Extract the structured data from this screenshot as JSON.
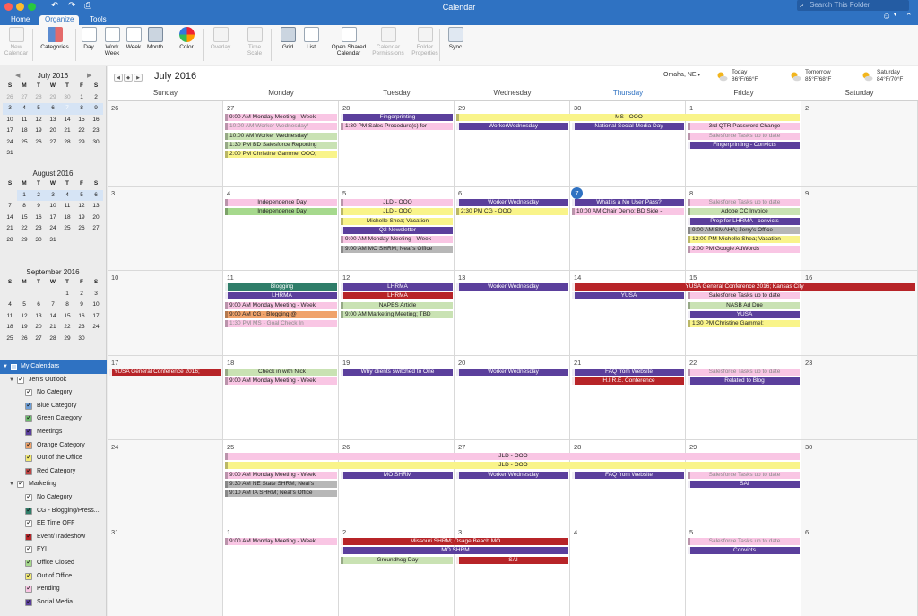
{
  "window": {
    "title": "Calendar",
    "search_placeholder": "Search This Folder"
  },
  "ribbon_tabs": [
    "Home",
    "Organize",
    "Tools"
  ],
  "toolbar": {
    "buttons": [
      {
        "label": "New\nCalendar",
        "disabled": true
      },
      {
        "label": "Categories",
        "disabled": false
      },
      {
        "label": "Day",
        "disabled": false
      },
      {
        "label": "Work\nWeek",
        "disabled": false
      },
      {
        "label": "Week",
        "disabled": false
      },
      {
        "label": "Month",
        "disabled": false,
        "selected": true
      },
      {
        "label": "Color",
        "disabled": false
      },
      {
        "label": "Overlay",
        "disabled": true
      },
      {
        "label": "Time\nScale",
        "disabled": true
      },
      {
        "label": "Grid",
        "disabled": false,
        "selected": true
      },
      {
        "label": "List",
        "disabled": false
      },
      {
        "label": "Open Shared\nCalendar",
        "disabled": false
      },
      {
        "label": "Calendar\nPermissions",
        "disabled": true
      },
      {
        "label": "Folder\nProperties",
        "disabled": true
      },
      {
        "label": "Sync",
        "disabled": false
      }
    ]
  },
  "colors": {
    "accent": "#2f72c2",
    "purple": "#5b3f9c",
    "pink": "#f9c6e4",
    "yellow": "#f9f48a",
    "green": "#c9e2b3",
    "gray": "#b7b7b7",
    "red": "#b72428",
    "teal": "#2f7d69",
    "orange": "#f0a36b",
    "bright_green": "#a6d98d"
  },
  "mini_calendars": [
    {
      "title": "July 2016",
      "days": [
        "S",
        "M",
        "T",
        "W",
        "T",
        "F",
        "S"
      ],
      "cells": [
        [
          "26",
          "o"
        ],
        [
          "27",
          "o"
        ],
        [
          "28",
          "o"
        ],
        [
          "29",
          "o"
        ],
        [
          "30",
          "o"
        ],
        [
          "1",
          ""
        ],
        [
          "2",
          ""
        ],
        [
          "3",
          "s"
        ],
        [
          "4",
          "s"
        ],
        [
          "5",
          "s"
        ],
        [
          "6",
          "s"
        ],
        [
          "7",
          "t"
        ],
        [
          "8",
          "s"
        ],
        [
          "9",
          "s"
        ],
        [
          "10",
          ""
        ],
        [
          "11",
          ""
        ],
        [
          "12",
          ""
        ],
        [
          "13",
          ""
        ],
        [
          "14",
          ""
        ],
        [
          "15",
          ""
        ],
        [
          "16",
          ""
        ],
        [
          "17",
          ""
        ],
        [
          "18",
          ""
        ],
        [
          "19",
          ""
        ],
        [
          "20",
          ""
        ],
        [
          "21",
          ""
        ],
        [
          "22",
          ""
        ],
        [
          "23",
          ""
        ],
        [
          "24",
          ""
        ],
        [
          "25",
          ""
        ],
        [
          "26",
          ""
        ],
        [
          "27",
          ""
        ],
        [
          "28",
          ""
        ],
        [
          "29",
          ""
        ],
        [
          "30",
          ""
        ],
        [
          "31",
          ""
        ]
      ]
    },
    {
      "title": "August 2016",
      "days": [
        "S",
        "M",
        "T",
        "W",
        "T",
        "F",
        "S"
      ],
      "cells": [
        [
          "",
          "o"
        ],
        [
          "1",
          "s"
        ],
        [
          "2",
          "s"
        ],
        [
          "3",
          "s"
        ],
        [
          "4",
          "s"
        ],
        [
          "5",
          "s"
        ],
        [
          "6",
          "s"
        ],
        [
          "7",
          ""
        ],
        [
          "8",
          ""
        ],
        [
          "9",
          ""
        ],
        [
          "10",
          ""
        ],
        [
          "11",
          ""
        ],
        [
          "12",
          ""
        ],
        [
          "13",
          ""
        ],
        [
          "14",
          ""
        ],
        [
          "15",
          ""
        ],
        [
          "16",
          ""
        ],
        [
          "17",
          ""
        ],
        [
          "18",
          ""
        ],
        [
          "19",
          ""
        ],
        [
          "20",
          ""
        ],
        [
          "21",
          ""
        ],
        [
          "22",
          ""
        ],
        [
          "23",
          ""
        ],
        [
          "24",
          ""
        ],
        [
          "25",
          ""
        ],
        [
          "26",
          ""
        ],
        [
          "27",
          ""
        ],
        [
          "28",
          ""
        ],
        [
          "29",
          ""
        ],
        [
          "30",
          ""
        ],
        [
          "31",
          ""
        ]
      ]
    },
    {
      "title": "September 2016",
      "days": [
        "S",
        "M",
        "T",
        "W",
        "T",
        "F",
        "S"
      ],
      "cells": [
        [
          "",
          "o"
        ],
        [
          "",
          "o"
        ],
        [
          "",
          "o"
        ],
        [
          "",
          "o"
        ],
        [
          "1",
          ""
        ],
        [
          "2",
          ""
        ],
        [
          "3",
          ""
        ],
        [
          "4",
          ""
        ],
        [
          "5",
          ""
        ],
        [
          "6",
          ""
        ],
        [
          "7",
          ""
        ],
        [
          "8",
          ""
        ],
        [
          "9",
          ""
        ],
        [
          "10",
          ""
        ],
        [
          "11",
          ""
        ],
        [
          "12",
          ""
        ],
        [
          "13",
          ""
        ],
        [
          "14",
          ""
        ],
        [
          "15",
          ""
        ],
        [
          "16",
          ""
        ],
        [
          "17",
          ""
        ],
        [
          "18",
          ""
        ],
        [
          "19",
          ""
        ],
        [
          "20",
          ""
        ],
        [
          "21",
          ""
        ],
        [
          "22",
          ""
        ],
        [
          "23",
          ""
        ],
        [
          "24",
          ""
        ],
        [
          "25",
          ""
        ],
        [
          "26",
          ""
        ],
        [
          "27",
          ""
        ],
        [
          "28",
          ""
        ],
        [
          "29",
          ""
        ],
        [
          "30",
          ""
        ]
      ]
    }
  ],
  "calendars": {
    "header": "My Calendars",
    "groups": [
      {
        "name": "Jen's Outlook",
        "items": [
          {
            "label": "No Category",
            "color": "#ffffff"
          },
          {
            "label": "Blue Category",
            "color": "#6e9fd8"
          },
          {
            "label": "Green Category",
            "color": "#6ebd6e"
          },
          {
            "label": "Meetings",
            "color": "#5b3f9c"
          },
          {
            "label": "Orange Category",
            "color": "#f0a36b"
          },
          {
            "label": "Out of the Office",
            "color": "#f3ea73"
          },
          {
            "label": "Red Category",
            "color": "#c04545"
          }
        ]
      },
      {
        "name": "Marketing",
        "items": [
          {
            "label": "No Category",
            "color": "#ffffff"
          },
          {
            "label": "CG - Blogging/Press...",
            "color": "#2f7d69"
          },
          {
            "label": "EE Time OFF",
            "color": "#ffffff"
          },
          {
            "label": "Event/Tradeshow",
            "color": "#b72428"
          },
          {
            "label": "FYI",
            "color": "#ffffff"
          },
          {
            "label": "Office Closed",
            "color": "#a6d98d"
          },
          {
            "label": "Out of Office",
            "color": "#f3ea73"
          },
          {
            "label": "Pending",
            "color": "#f9c6e4"
          },
          {
            "label": "Social Media",
            "color": "#5b3f9c"
          }
        ]
      }
    ]
  },
  "header": {
    "month_title": "July 2016",
    "location": "Omaha, NE",
    "weather": [
      {
        "day": "Today",
        "temps": "86°F/66°F"
      },
      {
        "day": "Tomorrow",
        "temps": "85°F/68°F"
      },
      {
        "day": "Saturday",
        "temps": "84°F/70°F"
      }
    ]
  },
  "weekdays": [
    "Sunday",
    "Monday",
    "Tuesday",
    "Wednesday",
    "Thursday",
    "Friday",
    "Saturday"
  ],
  "today_index": 4,
  "weeks": [
    [
      "26",
      "27",
      "28",
      "29",
      "30",
      "1",
      "2"
    ],
    [
      "3",
      "4",
      "5",
      "6",
      "7",
      "8",
      "9"
    ],
    [
      "10",
      "11",
      "12",
      "13",
      "14",
      "15",
      "16"
    ],
    [
      "17",
      "18",
      "19",
      "20",
      "21",
      "22",
      "23"
    ],
    [
      "24",
      "25",
      "26",
      "27",
      "28",
      "29",
      "30"
    ],
    [
      "31",
      "1",
      "2",
      "3",
      "4",
      "5",
      "6"
    ]
  ],
  "today_cell": [
    1,
    4
  ],
  "events": [
    {
      "w": 0,
      "d": 1,
      "s": 1,
      "r": 0,
      "k": "pink",
      "t": "9:00 AM   Monday Meeting - Week"
    },
    {
      "w": 0,
      "d": 1,
      "s": 1,
      "r": 1,
      "k": "pinkf",
      "t": "10:00 AM  Worker Wednesday/"
    },
    {
      "w": 0,
      "d": 1,
      "s": 1,
      "r": 2,
      "k": "green",
      "t": "10:00 AM  Worker Wednesday/"
    },
    {
      "w": 0,
      "d": 1,
      "s": 1,
      "r": 3,
      "k": "green",
      "t": "1:30 PM  BD Salesforce Reporting"
    },
    {
      "w": 0,
      "d": 1,
      "s": 1,
      "r": 4,
      "k": "yellow",
      "t": "2:00 PM   Christine Gammel OOO;"
    },
    {
      "w": 0,
      "d": 2,
      "s": 1,
      "r": 0,
      "k": "purple",
      "t": "Fingerprinting",
      "c": 1
    },
    {
      "w": 0,
      "d": 2,
      "s": 1,
      "r": 1,
      "k": "pink",
      "t": "1:30 PM  Sales Procedure(s) for"
    },
    {
      "w": 0,
      "d": 3,
      "s": 3,
      "r": 0,
      "k": "yellow",
      "t": "MS - OOO",
      "c": 1
    },
    {
      "w": 0,
      "d": 3,
      "s": 1,
      "r": 1,
      "k": "purple",
      "t": "WorkerWednesday",
      "c": 1
    },
    {
      "w": 0,
      "d": 4,
      "s": 1,
      "r": 1,
      "k": "purple",
      "t": "National Social Media Day",
      "c": 1
    },
    {
      "w": 0,
      "d": 5,
      "s": 1,
      "r": 1,
      "k": "pink",
      "t": "3rd QTR Password Change",
      "c": 1
    },
    {
      "w": 0,
      "d": 5,
      "s": 1,
      "r": 2,
      "k": "pinkf",
      "t": "Salesforce Tasks up to date",
      "c": 1
    },
    {
      "w": 0,
      "d": 5,
      "s": 1,
      "r": 3,
      "k": "purple",
      "t": "Fingerprinting - Convicts",
      "c": 1
    },
    {
      "w": 1,
      "d": 1,
      "s": 1,
      "r": 0,
      "k": "pink",
      "t": "Independence Day",
      "c": 1
    },
    {
      "w": 1,
      "d": 1,
      "s": 1,
      "r": 1,
      "k": "bgreen",
      "t": "Independence Day",
      "c": 1
    },
    {
      "w": 1,
      "d": 2,
      "s": 1,
      "r": 0,
      "k": "pink",
      "t": "JLD - OOO",
      "c": 1
    },
    {
      "w": 1,
      "d": 2,
      "s": 1,
      "r": 1,
      "k": "yellow",
      "t": "JLD - OOO",
      "c": 1
    },
    {
      "w": 1,
      "d": 2,
      "s": 1,
      "r": 2,
      "k": "yellow",
      "t": "Michelle Shea; Vacation",
      "c": 1
    },
    {
      "w": 1,
      "d": 2,
      "s": 1,
      "r": 3,
      "k": "purple",
      "t": "Q2 Newsletter",
      "c": 1
    },
    {
      "w": 1,
      "d": 2,
      "s": 1,
      "r": 4,
      "k": "pink",
      "t": "9:00 AM   Monday Meeting - Week"
    },
    {
      "w": 1,
      "d": 2,
      "s": 1,
      "r": 5,
      "k": "gray",
      "t": "9:00 AM   MO SHRM; Neal's Office"
    },
    {
      "w": 1,
      "d": 3,
      "s": 1,
      "r": 0,
      "k": "purple",
      "t": "Worker Wednesday",
      "c": 1
    },
    {
      "w": 1,
      "d": 3,
      "s": 1,
      "r": 1,
      "k": "yellow",
      "t": "2:30 PM   CG - OOO"
    },
    {
      "w": 1,
      "d": 4,
      "s": 1,
      "r": 0,
      "k": "purple",
      "t": "What is a No User Pass?",
      "c": 1
    },
    {
      "w": 1,
      "d": 4,
      "s": 1,
      "r": 1,
      "k": "pink",
      "t": "10:00 AM   Chair Demo; BD Side -"
    },
    {
      "w": 1,
      "d": 5,
      "s": 1,
      "r": 0,
      "k": "pinkf",
      "t": "Salesforce Tasks up to date",
      "c": 1
    },
    {
      "w": 1,
      "d": 5,
      "s": 1,
      "r": 1,
      "k": "green",
      "t": "Adobe CC Invoice",
      "c": 1
    },
    {
      "w": 1,
      "d": 5,
      "s": 1,
      "r": 2,
      "k": "purple",
      "t": "Prep for LHRMA - convicts",
      "c": 1
    },
    {
      "w": 1,
      "d": 5,
      "s": 1,
      "r": 3,
      "k": "gray",
      "t": "9:00 AM   SMAHA; Jerry's Office"
    },
    {
      "w": 1,
      "d": 5,
      "s": 1,
      "r": 4,
      "k": "yellow",
      "t": "12:00 PM   Michelle Shea; Vacation"
    },
    {
      "w": 1,
      "d": 5,
      "s": 1,
      "r": 5,
      "k": "pink",
      "t": "2:00 PM   Google AdWords"
    },
    {
      "w": 2,
      "d": 1,
      "s": 1,
      "r": 0,
      "k": "teal",
      "t": "Blogging",
      "c": 1
    },
    {
      "w": 2,
      "d": 1,
      "s": 1,
      "r": 1,
      "k": "purple",
      "t": "LHRMA",
      "c": 1
    },
    {
      "w": 2,
      "d": 1,
      "s": 1,
      "r": 2,
      "k": "pink",
      "t": "9:00 AM   Monday Meeting - Week"
    },
    {
      "w": 2,
      "d": 1,
      "s": 1,
      "r": 3,
      "k": "orange",
      "t": "9:00 AM   CG - Blogging @"
    },
    {
      "w": 2,
      "d": 1,
      "s": 1,
      "r": 4,
      "k": "pinkf",
      "t": "1:30 PM   MS - Goal Check In"
    },
    {
      "w": 2,
      "d": 2,
      "s": 1,
      "r": 0,
      "k": "purple",
      "t": "LHRMA",
      "c": 1
    },
    {
      "w": 2,
      "d": 2,
      "s": 1,
      "r": 1,
      "k": "red",
      "t": "LHRMA",
      "c": 1
    },
    {
      "w": 2,
      "d": 2,
      "s": 1,
      "r": 2,
      "k": "green",
      "t": "NAPBS Article",
      "c": 1
    },
    {
      "w": 2,
      "d": 2,
      "s": 1,
      "r": 3,
      "k": "green",
      "t": "9:00 AM   Marketing Meeting; TBD"
    },
    {
      "w": 2,
      "d": 3,
      "s": 1,
      "r": 0,
      "k": "purple",
      "t": "Worker Wednesday",
      "c": 1
    },
    {
      "w": 2,
      "d": 4,
      "s": 3,
      "r": 0,
      "k": "red",
      "t": "YUSA General Conference 2016; Kansas City",
      "c": 1
    },
    {
      "w": 2,
      "d": 4,
      "s": 1,
      "r": 1,
      "k": "purple",
      "t": "YUSA",
      "c": 1
    },
    {
      "w": 2,
      "d": 5,
      "s": 1,
      "r": 1,
      "k": "pink",
      "t": "Salesforce Tasks up to date",
      "c": 1
    },
    {
      "w": 2,
      "d": 5,
      "s": 1,
      "r": 2,
      "k": "green",
      "t": "NASB Ad Due",
      "c": 1
    },
    {
      "w": 2,
      "d": 5,
      "s": 1,
      "r": 3,
      "k": "purple",
      "t": "YUSA",
      "c": 1
    },
    {
      "w": 2,
      "d": 5,
      "s": 1,
      "r": 4,
      "k": "yellow",
      "t": "1:30 PM   Christine Gammel;"
    },
    {
      "w": 3,
      "d": 0,
      "s": 1,
      "r": 0,
      "k": "red",
      "t": "YUSA General Conference 2016;"
    },
    {
      "w": 3,
      "d": 1,
      "s": 1,
      "r": 0,
      "k": "green",
      "t": "Check in with Nick",
      "c": 1
    },
    {
      "w": 3,
      "d": 1,
      "s": 1,
      "r": 1,
      "k": "pink",
      "t": "9:00 AM   Monday Meeting - Week"
    },
    {
      "w": 3,
      "d": 2,
      "s": 1,
      "r": 0,
      "k": "purple",
      "t": "Why clients switched to One",
      "c": 1
    },
    {
      "w": 3,
      "d": 3,
      "s": 1,
      "r": 0,
      "k": "purple",
      "t": "Worker Wednesday",
      "c": 1
    },
    {
      "w": 3,
      "d": 4,
      "s": 1,
      "r": 0,
      "k": "purple",
      "t": "FAQ from Website",
      "c": 1
    },
    {
      "w": 3,
      "d": 4,
      "s": 1,
      "r": 1,
      "k": "red",
      "t": "H.I.R.E. Conference",
      "c": 1
    },
    {
      "w": 3,
      "d": 5,
      "s": 1,
      "r": 0,
      "k": "pinkf",
      "t": "Salesforce Tasks up to date",
      "c": 1
    },
    {
      "w": 3,
      "d": 5,
      "s": 1,
      "r": 1,
      "k": "purple",
      "t": "Related to Blog",
      "c": 1
    },
    {
      "w": 4,
      "d": 1,
      "s": 5,
      "r": 0,
      "k": "pink",
      "t": "JLD - OOO",
      "c": 1
    },
    {
      "w": 4,
      "d": 1,
      "s": 5,
      "r": 1,
      "k": "yellow",
      "t": "JLD - OOO",
      "c": 1
    },
    {
      "w": 4,
      "d": 1,
      "s": 1,
      "r": 2,
      "k": "pink",
      "t": "9:00 AM   Monday Meeting - Week"
    },
    {
      "w": 4,
      "d": 1,
      "s": 1,
      "r": 3,
      "k": "gray",
      "t": "9:30 AM   NE State SHRM; Neal's"
    },
    {
      "w": 4,
      "d": 1,
      "s": 1,
      "r": 4,
      "k": "gray",
      "t": "9:10 AM   IA SHRM; Neal's Office"
    },
    {
      "w": 4,
      "d": 2,
      "s": 1,
      "r": 2,
      "k": "purple",
      "t": "MO SHRM",
      "c": 1
    },
    {
      "w": 4,
      "d": 3,
      "s": 1,
      "r": 2,
      "k": "purple",
      "t": "Worker Wednesday",
      "c": 1
    },
    {
      "w": 4,
      "d": 4,
      "s": 1,
      "r": 2,
      "k": "purple",
      "t": "FAQ from Website",
      "c": 1
    },
    {
      "w": 4,
      "d": 5,
      "s": 1,
      "r": 2,
      "k": "pinkf",
      "t": "Salesforce Tasks up to date",
      "c": 1
    },
    {
      "w": 4,
      "d": 5,
      "s": 1,
      "r": 3,
      "k": "purple",
      "t": "SAI",
      "c": 1
    },
    {
      "w": 5,
      "d": 1,
      "s": 1,
      "r": 0,
      "k": "pink",
      "t": "9:00 AM   Monday Meeting - Week"
    },
    {
      "w": 5,
      "d": 2,
      "s": 2,
      "r": 0,
      "k": "red",
      "t": "Missouri SHRM; Osage Beach MO",
      "c": 1
    },
    {
      "w": 5,
      "d": 2,
      "s": 2,
      "r": 1,
      "k": "purple",
      "t": "MO SHRM",
      "c": 1
    },
    {
      "w": 5,
      "d": 2,
      "s": 1,
      "r": 2,
      "k": "green",
      "t": "Groundhog Day",
      "c": 1
    },
    {
      "w": 5,
      "d": 3,
      "s": 1,
      "r": 2,
      "k": "red",
      "t": "SAI",
      "c": 1
    },
    {
      "w": 5,
      "d": 5,
      "s": 1,
      "r": 0,
      "k": "pinkf",
      "t": "Salesforce Tasks up to date",
      "c": 1
    },
    {
      "w": 5,
      "d": 5,
      "s": 1,
      "r": 1,
      "k": "purple",
      "t": "Convicts",
      "c": 1
    }
  ]
}
